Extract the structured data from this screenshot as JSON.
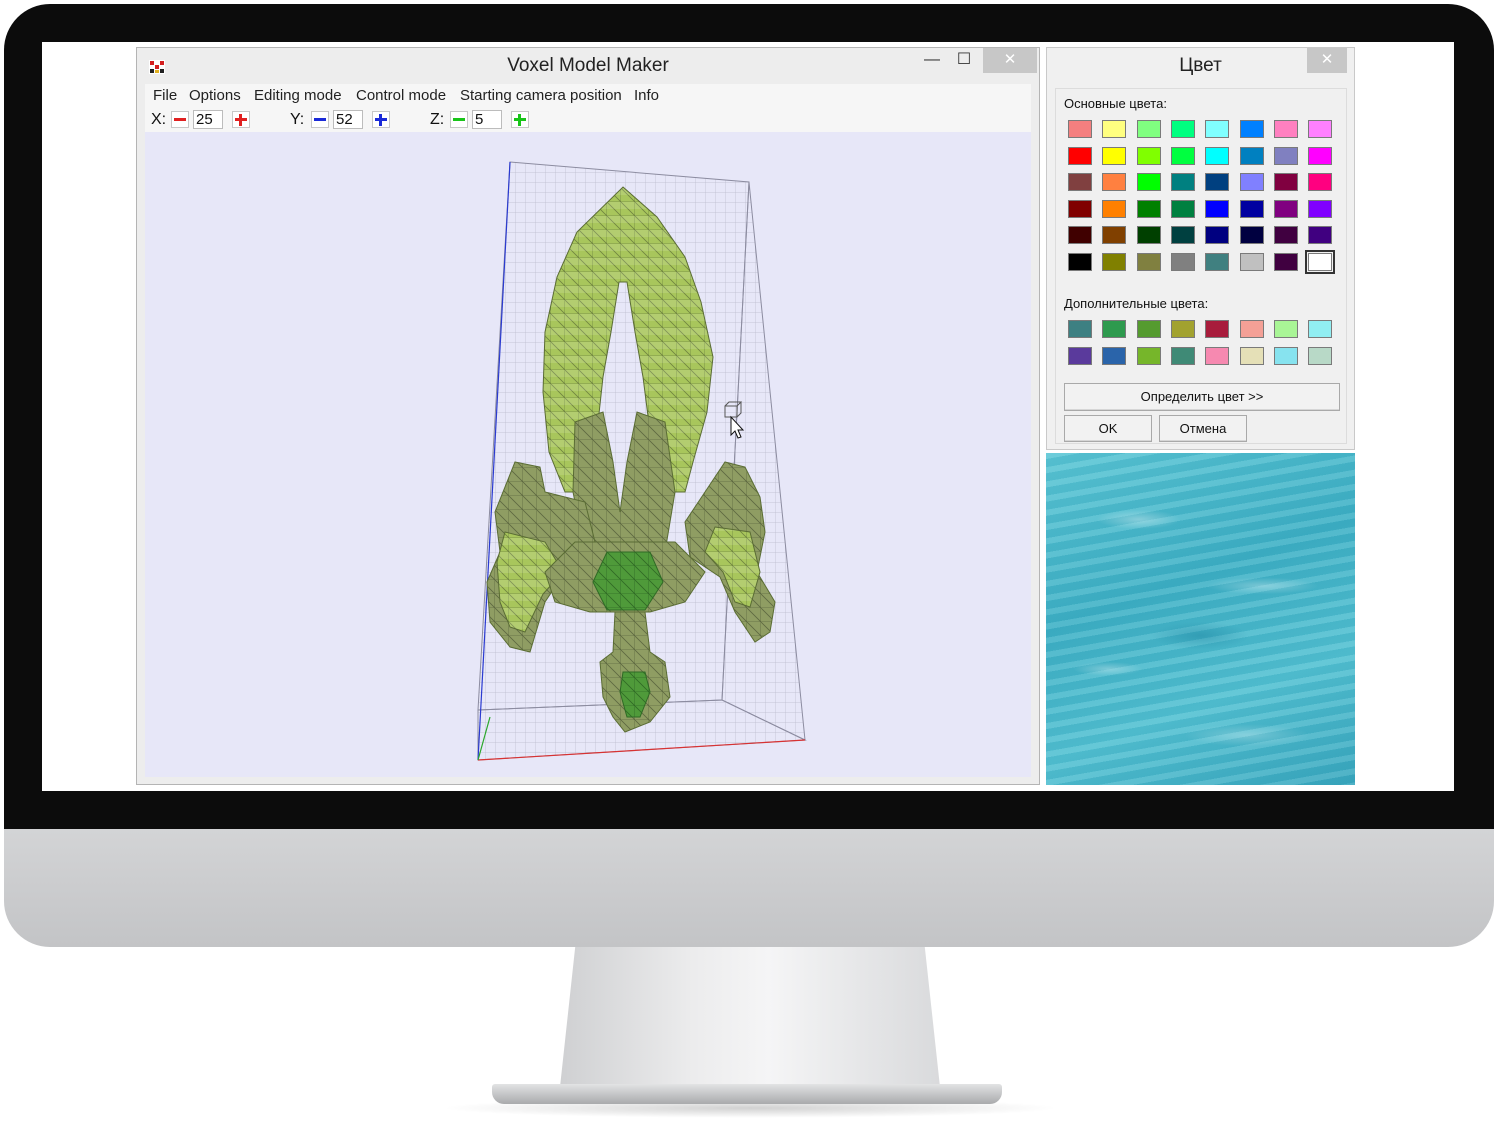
{
  "app": {
    "title": "Voxel Model Maker",
    "icon": "app-logo-icon",
    "window_buttons": {
      "minimize": "—",
      "maximize": "☐",
      "close": "✕"
    },
    "menu": [
      "File",
      "Options",
      "Editing mode",
      "Control mode",
      "Starting camera position",
      "Info"
    ],
    "toolbar": {
      "x": {
        "label": "X:",
        "value": "25",
        "color": "#e02020"
      },
      "y": {
        "label": "Y:",
        "value": "52",
        "color": "#1a2ad8"
      },
      "z": {
        "label": "Z:",
        "value": "5",
        "color": "#19c419"
      }
    },
    "viewport": {
      "background": "#e7e7f8",
      "model_colors": [
        "#a6c45a",
        "#8e9c62",
        "#5e7f3a",
        "#3f8a2f"
      ]
    }
  },
  "color_dialog": {
    "title": "Цвет",
    "close": "✕",
    "basic_label": "Основные цвета:",
    "basic_colors": [
      [
        "#f47f7f",
        "#ffff80",
        "#80ff80",
        "#00ff80",
        "#80ffff",
        "#0080ff",
        "#ff80c0",
        "#ff80ff"
      ],
      [
        "#ff0000",
        "#ffff00",
        "#80ff00",
        "#00ff40",
        "#00ffff",
        "#0080c0",
        "#8080c0",
        "#ff00ff"
      ],
      [
        "#804040",
        "#ff8040",
        "#00ff00",
        "#008080",
        "#004080",
        "#8080ff",
        "#800040",
        "#ff0080"
      ],
      [
        "#800000",
        "#ff8000",
        "#008000",
        "#008040",
        "#0000ff",
        "#0000a0",
        "#800080",
        "#8000ff"
      ],
      [
        "#400000",
        "#804000",
        "#004000",
        "#004040",
        "#000080",
        "#000040",
        "#400040",
        "#400080"
      ],
      [
        "#000000",
        "#808000",
        "#808040",
        "#808080",
        "#408080",
        "#c0c0c0",
        "#400040",
        "#ffffff"
      ]
    ],
    "custom_label": "Дополнительные цвета:",
    "custom_colors": [
      [
        "#3d8082",
        "#2e9a4e",
        "#559b2f",
        "#a2a22f",
        "#a81c3c",
        "#f4a096",
        "#a9f596",
        "#91eef2"
      ],
      [
        "#5a3a9c",
        "#2a64aa",
        "#76b62a",
        "#3f8a76",
        "#f689b0",
        "#e5e0b7",
        "#87e3ef",
        "#b8d9c7"
      ]
    ],
    "define_button": "Определить цвет >>",
    "ok_button": "OK",
    "cancel_button": "Отмена"
  }
}
